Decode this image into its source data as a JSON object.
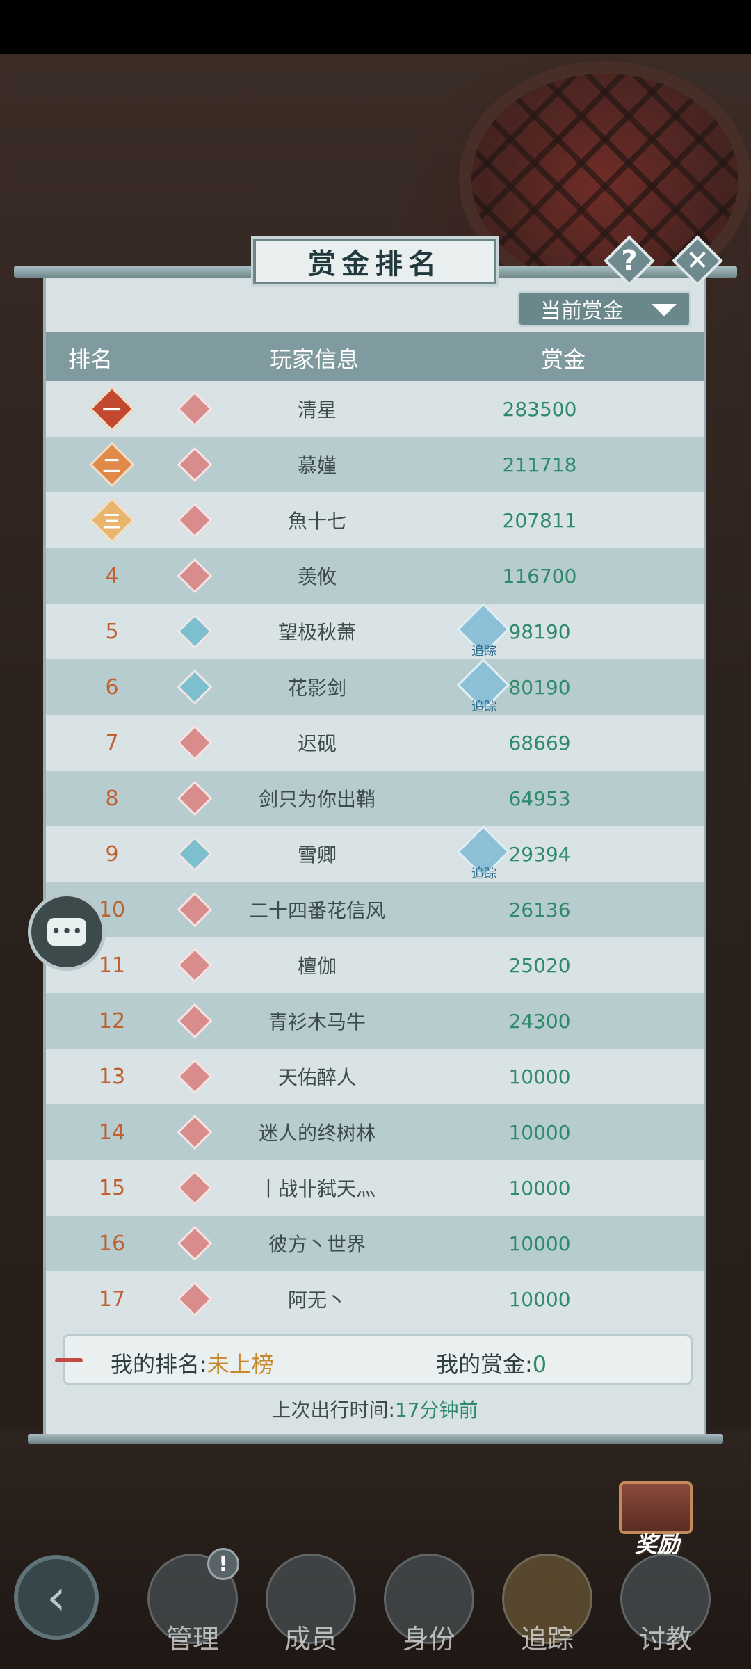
{
  "panel": {
    "title": "赏金排名",
    "help_glyph": "?",
    "close_glyph": "✕",
    "dropdown_label": "当前赏金"
  },
  "table": {
    "headers": {
      "rank": "排名",
      "player": "玩家信息",
      "bounty": "赏金"
    },
    "rows": [
      {
        "rank": "一",
        "name": "清星",
        "bounty": "283500",
        "clan": "red",
        "track": false
      },
      {
        "rank": "二",
        "name": "慕嫤",
        "bounty": "211718",
        "clan": "red",
        "track": false
      },
      {
        "rank": "三",
        "name": "魚十七",
        "bounty": "207811",
        "clan": "red",
        "track": false
      },
      {
        "rank": "4",
        "name": "羡攸",
        "bounty": "116700",
        "clan": "red",
        "track": false
      },
      {
        "rank": "5",
        "name": "望极秋萧",
        "bounty": "98190",
        "clan": "blue",
        "track": true
      },
      {
        "rank": "6",
        "name": "花影剑",
        "bounty": "80190",
        "clan": "blue",
        "track": true
      },
      {
        "rank": "7",
        "name": "迟砚",
        "bounty": "68669",
        "clan": "red",
        "track": false
      },
      {
        "rank": "8",
        "name": "剑只为你出鞘",
        "bounty": "64953",
        "clan": "red",
        "track": false
      },
      {
        "rank": "9",
        "name": "雪卿",
        "bounty": "29394",
        "clan": "blue",
        "track": true
      },
      {
        "rank": "10",
        "name": "二十四番花信风",
        "bounty": "26136",
        "clan": "red",
        "track": false
      },
      {
        "rank": "11",
        "name": "檀伽",
        "bounty": "25020",
        "clan": "red",
        "track": false
      },
      {
        "rank": "12",
        "name": "青衫木马牛",
        "bounty": "24300",
        "clan": "red",
        "track": false
      },
      {
        "rank": "13",
        "name": "天佑醉人",
        "bounty": "10000",
        "clan": "red",
        "track": false
      },
      {
        "rank": "14",
        "name": "迷人的终树林",
        "bounty": "10000",
        "clan": "red",
        "track": false
      },
      {
        "rank": "15",
        "name": "丨战卝弑天灬",
        "bounty": "10000",
        "clan": "red",
        "track": false
      },
      {
        "rank": "16",
        "name": "彼方丶世界",
        "bounty": "10000",
        "clan": "red",
        "track": false
      },
      {
        "rank": "17",
        "name": "阿无丶",
        "bounty": "10000",
        "clan": "red",
        "track": false
      }
    ],
    "track_label": "追踪"
  },
  "my_info": {
    "rank_label": "我的排名:",
    "rank_value": "未上榜",
    "bounty_label": "我的赏金:",
    "bounty_value": "0",
    "last_out_label": "上次出行时间:",
    "last_out_value": "17分钟前"
  },
  "reward": {
    "label": "奖励"
  },
  "nav": {
    "items": [
      "管理",
      "成员",
      "身份",
      "追踪",
      "讨教"
    ],
    "badge": "!"
  },
  "colors": {
    "accent_green": "#2e8a6a",
    "rank_orange": "#c0602e",
    "header_bg": "#7f9ba0"
  }
}
